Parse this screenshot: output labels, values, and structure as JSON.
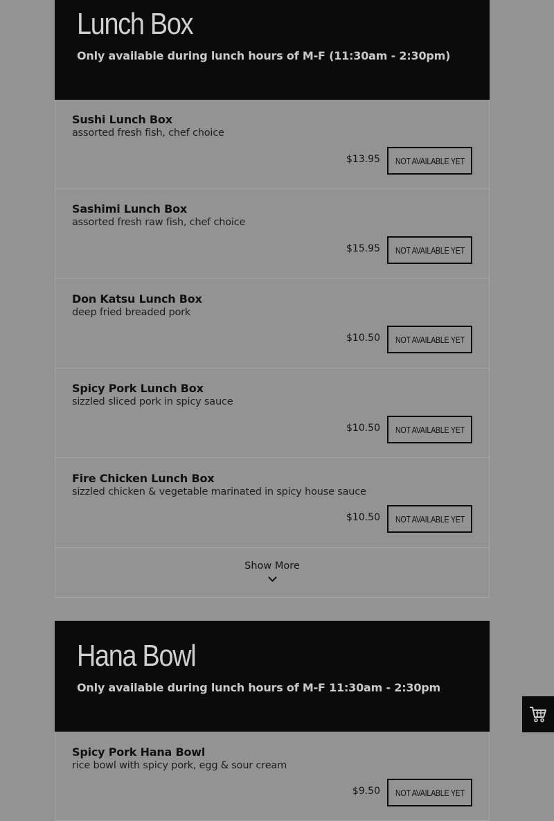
{
  "sections": [
    {
      "title": "Lunch Box",
      "subtitle": "Only available during lunch hours of M-F (11:30am - 2:30pm)",
      "items": [
        {
          "name": "Sushi Lunch Box",
          "description": "assorted fresh fish, chef choice",
          "price": "$13.95",
          "button": "NOT AVAILABLE YET"
        },
        {
          "name": "Sashimi Lunch Box",
          "description": "assorted fresh raw fish, chef choice",
          "price": "$15.95",
          "button": "NOT AVAILABLE YET"
        },
        {
          "name": "Don Katsu Lunch Box",
          "description": "deep fried breaded pork",
          "price": "$10.50",
          "button": "NOT AVAILABLE YET"
        },
        {
          "name": "Spicy Pork Lunch Box",
          "description": "sizzled sliced pork in spicy sauce",
          "price": "$10.50",
          "button": "NOT AVAILABLE YET"
        },
        {
          "name": "Fire Chicken Lunch Box",
          "description": "sizzled chicken & vegetable marinated in spicy house sauce",
          "price": "$10.50",
          "button": "NOT AVAILABLE YET"
        }
      ],
      "show_more": "Show More"
    },
    {
      "title": "Hana Bowl",
      "subtitle": "Only available during lunch hours of M-F 11:30am - 2:30pm",
      "items": [
        {
          "name": "Spicy Pork Hana Bowl",
          "description": "rice bowl with spicy pork, egg & sour cream",
          "price": "$9.50",
          "button": "NOT AVAILABLE YET"
        }
      ]
    }
  ],
  "cart": {
    "icon": "shopping-cart-icon"
  }
}
